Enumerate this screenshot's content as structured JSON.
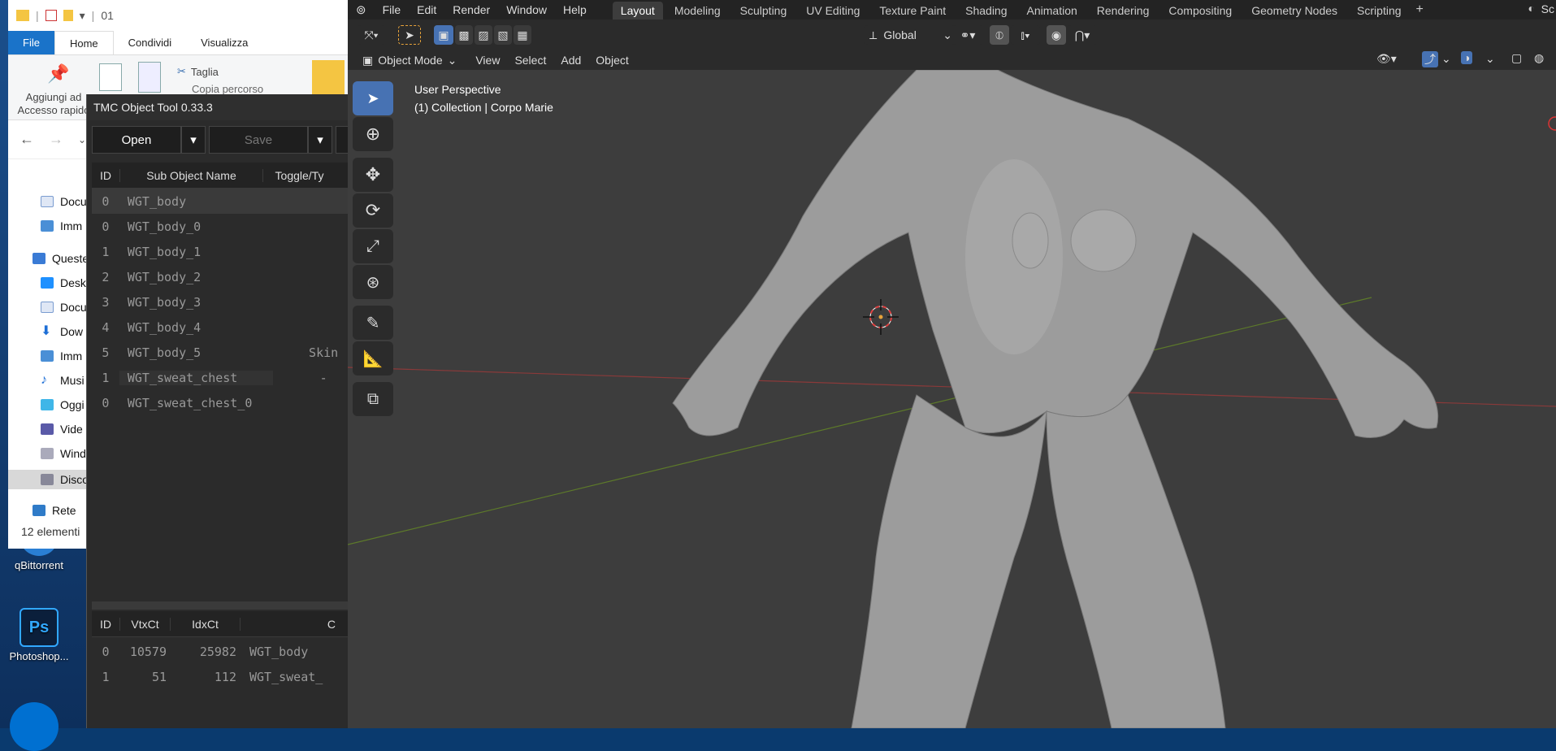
{
  "explorer": {
    "path": "01",
    "tabs": [
      "File",
      "Home",
      "Condividi",
      "Visualizza"
    ],
    "ribbon": {
      "pin_label": "Aggiungi ad Accesso rapido",
      "cut_label": "Taglia",
      "copy_path_label": "Copia percorso"
    },
    "tree": [
      "Docu",
      "Imm",
      "Queste",
      "Desk",
      "Docu",
      "Dow",
      "Imm",
      "Musi",
      "Oggi",
      "Vide",
      "Wind",
      "Disco",
      "Rete"
    ],
    "status": "12 elementi"
  },
  "desktop": {
    "icons": [
      "qBittorrent",
      "Photoshop..."
    ]
  },
  "tmc": {
    "title": "TMC Object Tool 0.33.3",
    "open_label": "Open",
    "save_label": "Save",
    "headers": {
      "id": "ID",
      "name": "Sub Object Name",
      "toggle": "Toggle/Ty"
    },
    "rows": [
      {
        "id": "0",
        "name": "WGT_body",
        "extra": ""
      },
      {
        "id": "0",
        "name": "WGT_body_0",
        "extra": ""
      },
      {
        "id": "1",
        "name": "WGT_body_1",
        "extra": ""
      },
      {
        "id": "2",
        "name": "WGT_body_2",
        "extra": ""
      },
      {
        "id": "3",
        "name": "WGT_body_3",
        "extra": ""
      },
      {
        "id": "4",
        "name": "WGT_body_4",
        "extra": ""
      },
      {
        "id": "5",
        "name": "WGT_body_5",
        "extra": "Skin"
      },
      {
        "id": "1",
        "name": "WGT_sweat_chest",
        "extra": "-"
      },
      {
        "id": "0",
        "name": "WGT_sweat_chest_0",
        "extra": ""
      }
    ],
    "bottom_headers": {
      "id": "ID",
      "vtx": "VtxCt",
      "idx": "IdxCt",
      "c": "C"
    },
    "bottom_rows": [
      {
        "id": "0",
        "vtx": "10579",
        "idx": "25982",
        "name": "WGT_body"
      },
      {
        "id": "1",
        "vtx": "51",
        "idx": "112",
        "name": "WGT_sweat_"
      }
    ]
  },
  "blender": {
    "menus": [
      "File",
      "Edit",
      "Render",
      "Window",
      "Help"
    ],
    "workspaces": [
      "Layout",
      "Modeling",
      "Sculpting",
      "UV Editing",
      "Texture Paint",
      "Shading",
      "Animation",
      "Rendering",
      "Compositing",
      "Geometry Nodes",
      "Scripting"
    ],
    "active_workspace": "Layout",
    "transform_orientation": "Global",
    "mode": "Object Mode",
    "view_menus": [
      "View",
      "Select",
      "Add",
      "Object"
    ],
    "overlay_line1": "User Perspective",
    "overlay_line2": "(1) Collection | Corpo Marie",
    "scene_label_cut": "Sc"
  }
}
